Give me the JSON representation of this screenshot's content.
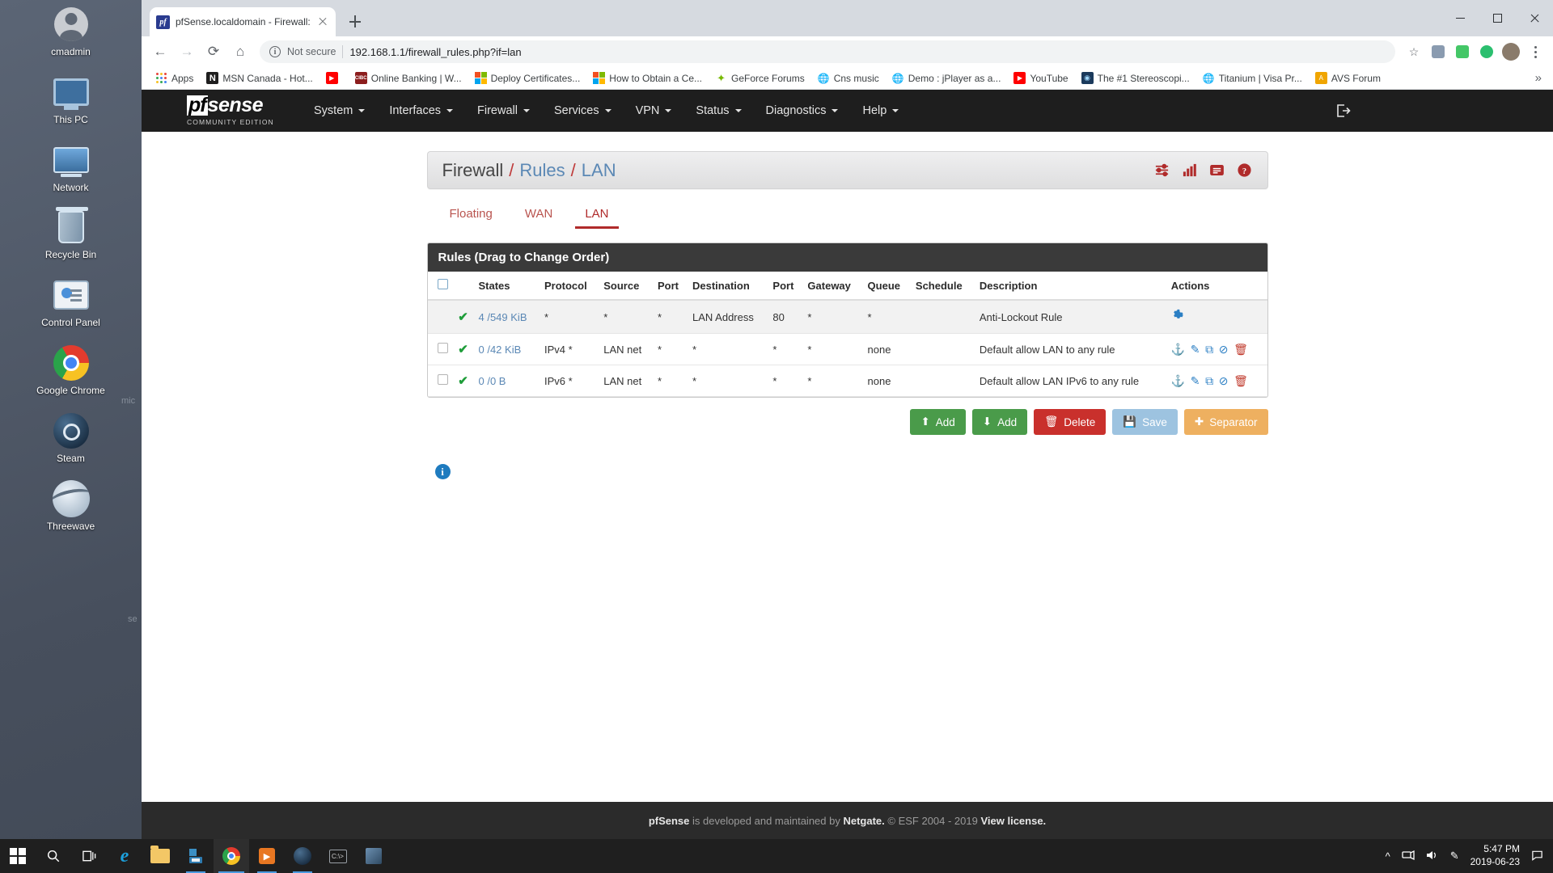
{
  "desktop": {
    "icons": [
      {
        "name": "cmadmin",
        "icon": "user-icon"
      },
      {
        "name": "This PC",
        "icon": "computer-icon"
      },
      {
        "name": "Network",
        "icon": "network-icon"
      },
      {
        "name": "Recycle Bin",
        "icon": "recycle-bin-icon"
      },
      {
        "name": "Control Panel",
        "icon": "control-panel-icon"
      },
      {
        "name": "Google Chrome",
        "icon": "chrome-icon"
      },
      {
        "name": "Steam",
        "icon": "steam-icon"
      },
      {
        "name": "Threewave",
        "icon": "threewave-icon"
      }
    ],
    "ghost_labels": [
      "mic",
      "se"
    ]
  },
  "browser": {
    "tab": {
      "title": "pfSense.localdomain - Firewall: R",
      "favicon": "pf-favicon"
    },
    "new_tab_label": "+",
    "window_controls": {
      "minimize": "minimize",
      "maximize": "maximize",
      "close": "close"
    },
    "toolbar": {
      "back": "back-arrow",
      "forward": "forward-arrow",
      "reload": "reload-arrow",
      "home": "home-icon",
      "security_label": "Not secure",
      "url": "192.168.1.1/firewall_rules.php?if=lan",
      "star": "bookmark-star-icon",
      "menu": "chrome-menu-icon"
    },
    "bookmarks": [
      {
        "label": "Apps",
        "icon": "apps-grid-icon"
      },
      {
        "label": "MSN Canada - Hot...",
        "icon": "msn-icon"
      },
      {
        "label": "",
        "icon": "youtube-icon"
      },
      {
        "label": "Online Banking | W...",
        "icon": "cibc-icon"
      },
      {
        "label": "Deploy Certificates...",
        "icon": "microsoft-icon"
      },
      {
        "label": "How to Obtain a Ce...",
        "icon": "microsoft-icon"
      },
      {
        "label": "GeForce Forums",
        "icon": "nvidia-icon"
      },
      {
        "label": "Cns music",
        "icon": "globe-icon"
      },
      {
        "label": "Demo : jPlayer as a...",
        "icon": "globe-icon"
      },
      {
        "label": "YouTube",
        "icon": "youtube-icon"
      },
      {
        "label": "The #1 Stereoscopi...",
        "icon": "stereo-icon"
      },
      {
        "label": "Titanium | Visa Pr...",
        "icon": "globe-icon"
      },
      {
        "label": "AVS Forum",
        "icon": "avs-icon"
      }
    ],
    "bookmarks_overflow": "»"
  },
  "pfsense": {
    "brand": {
      "mark": "pf",
      "wordmark": "sense",
      "subtitle": "COMMUNITY EDITION"
    },
    "nav": [
      {
        "label": "System",
        "has_caret": true
      },
      {
        "label": "Interfaces",
        "has_caret": true
      },
      {
        "label": "Firewall",
        "has_caret": true
      },
      {
        "label": "Services",
        "has_caret": true
      },
      {
        "label": "VPN",
        "has_caret": true
      },
      {
        "label": "Status",
        "has_caret": true
      },
      {
        "label": "Diagnostics",
        "has_caret": true
      },
      {
        "label": "Help",
        "has_caret": true
      }
    ],
    "logout_icon": "logout-icon",
    "breadcrumb": {
      "root": "Firewall",
      "sep": "/",
      "mid": "Rules",
      "leaf": "LAN"
    },
    "header_icons": [
      {
        "name": "sliders-icon"
      },
      {
        "name": "bar-chart-icon"
      },
      {
        "name": "list-icon"
      },
      {
        "name": "help-icon"
      }
    ],
    "tabs": [
      {
        "label": "Floating",
        "active": false
      },
      {
        "label": "WAN",
        "active": false
      },
      {
        "label": "LAN",
        "active": true
      }
    ],
    "panel_title": "Rules (Drag to Change Order)",
    "table": {
      "columns": [
        "",
        "",
        "States",
        "Protocol",
        "Source",
        "Port",
        "Destination",
        "Port",
        "Gateway",
        "Queue",
        "Schedule",
        "Description",
        "Actions"
      ],
      "rows": [
        {
          "checkbox": false,
          "locked": true,
          "status": "pass",
          "states": "4 /549 KiB",
          "protocol": "*",
          "source": "*",
          "src_port": "*",
          "destination": "LAN Address",
          "dst_port": "80",
          "gateway": "*",
          "queue": "*",
          "schedule": "",
          "description": "Anti-Lockout Rule",
          "actions": [
            "gear-icon"
          ]
        },
        {
          "checkbox": true,
          "locked": false,
          "status": "pass",
          "states": "0 /42 KiB",
          "protocol": "IPv4 *",
          "source": "LAN net",
          "src_port": "*",
          "destination": "*",
          "dst_port": "*",
          "gateway": "*",
          "queue": "none",
          "schedule": "",
          "description": "Default allow LAN to any rule",
          "actions": [
            "anchor-icon",
            "edit-icon",
            "copy-icon",
            "disable-icon",
            "delete-icon"
          ]
        },
        {
          "checkbox": true,
          "locked": false,
          "status": "pass",
          "states": "0 /0 B",
          "protocol": "IPv6 *",
          "source": "LAN net",
          "src_port": "*",
          "destination": "*",
          "dst_port": "*",
          "gateway": "*",
          "queue": "none",
          "schedule": "",
          "description": "Default allow LAN IPv6 to any rule",
          "actions": [
            "anchor-icon",
            "edit-icon",
            "copy-icon",
            "disable-icon",
            "delete-icon"
          ]
        }
      ]
    },
    "buttons": [
      {
        "label": "Add",
        "icon": "arrow-up-icon",
        "color": "#4a9b4a",
        "name": "add-rule-top-button"
      },
      {
        "label": "Add",
        "icon": "arrow-down-icon",
        "color": "#4a9b4a",
        "name": "add-rule-bottom-button"
      },
      {
        "label": "Delete",
        "icon": "trash-icon",
        "color": "#c9302c",
        "name": "delete-button"
      },
      {
        "label": "Save",
        "icon": "save-icon",
        "color": "#9dc3e0",
        "name": "save-button"
      },
      {
        "label": "Separator",
        "icon": "plus-icon",
        "color": "#eeb060",
        "name": "separator-button"
      }
    ],
    "info_icon": "info-icon",
    "footer": {
      "brand": "pfSense",
      "text1": " is developed and maintained by ",
      "company": "Netgate.",
      "text2": " © ESF 2004 - 2019 ",
      "license_link": "View license."
    }
  },
  "taskbar": {
    "items": [
      {
        "name": "start-button",
        "icon": "windows-logo-icon"
      },
      {
        "name": "search-button",
        "icon": "search-icon"
      },
      {
        "name": "task-view-button",
        "icon": "task-view-icon"
      },
      {
        "name": "internet-explorer-button",
        "icon": "ie-icon"
      },
      {
        "name": "file-explorer-button",
        "icon": "folder-icon"
      },
      {
        "name": "store-button",
        "icon": "store-icon"
      },
      {
        "name": "chrome-button",
        "icon": "chrome-icon"
      },
      {
        "name": "media-player-button",
        "icon": "media-icon"
      },
      {
        "name": "steam-button",
        "icon": "steam-icon"
      },
      {
        "name": "command-prompt-button",
        "icon": "cmd-icon"
      },
      {
        "name": "vm-button",
        "icon": "vm-icon"
      }
    ],
    "tray": {
      "chevron": "^",
      "network": "network-tray-icon",
      "volume": "volume-tray-icon",
      "pen": "pen-tray-icon",
      "time": "5:47 PM",
      "date": "2019-06-23",
      "action_center": "action-center-icon"
    }
  }
}
